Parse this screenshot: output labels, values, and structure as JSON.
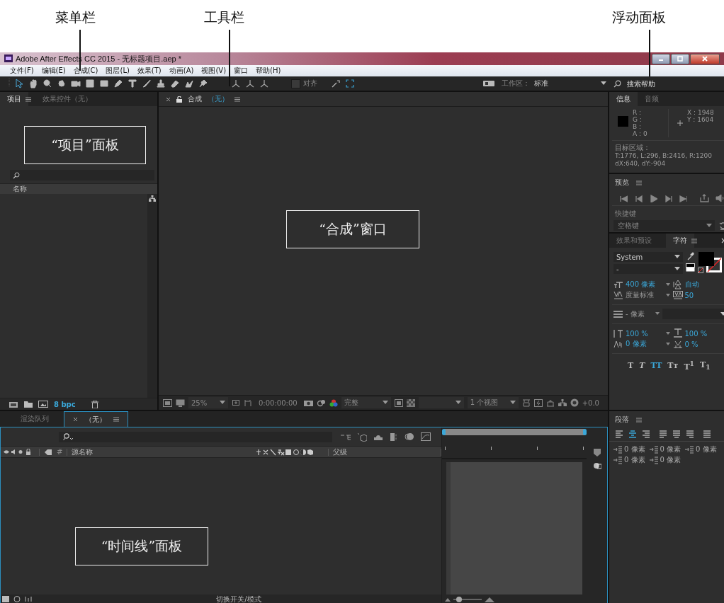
{
  "annotations": [
    {
      "label": "菜单栏"
    },
    {
      "label": "工具栏"
    },
    {
      "label": "浮动面板"
    }
  ],
  "callouts": [
    {
      "label": "“项目”面板"
    },
    {
      "label": "“合成”窗口"
    },
    {
      "label": "“时间线”面板"
    }
  ],
  "window": {
    "title": "Adobe After Effects CC 2015 - 无标题项目.aep *"
  },
  "menu": [
    {
      "label": "文件(F)"
    },
    {
      "label": "编辑(E)"
    },
    {
      "label": "合成(C)"
    },
    {
      "label": "图层(L)"
    },
    {
      "label": "效果(T)"
    },
    {
      "label": "动画(A)"
    },
    {
      "label": "视图(V)"
    },
    {
      "label": "窗口"
    },
    {
      "label": "帮助(H)"
    }
  ],
  "toolbar": {
    "snap": {
      "label": "对齐",
      "checked": false
    },
    "workspace_label": "工作区：",
    "workspace": "标准",
    "search": {
      "placeholder": "搜索帮助"
    }
  },
  "project": {
    "tabs": [
      {
        "label": "项目",
        "selected": true
      },
      {
        "label": "效果控件（无）",
        "selected": false
      }
    ],
    "name_column": "名称",
    "bpc": "8 bpc"
  },
  "composition": {
    "tab": {
      "label": "合成",
      "comp": "（无）"
    },
    "zoom": "25%",
    "timecode": "0:00:00:00",
    "resolution": "完整",
    "views": "1 个视图",
    "exposure": "+0.0"
  },
  "info": {
    "tabs": [
      {
        "label": "信息",
        "selected": true
      },
      {
        "label": "音频",
        "selected": false
      }
    ],
    "channels": [
      "R :",
      "G :",
      "B :",
      "A : 0"
    ],
    "coords": [
      "X : 1948",
      "Y : 1604"
    ],
    "target_label": "目标区域：",
    "target": "T:1776, L:296, B:2416, R:1200",
    "delta": "dX:640, dY:-904"
  },
  "preview": {
    "title": "预览",
    "shortcut_label": "快捷键",
    "shortcut": "空格键"
  },
  "character": {
    "tabs": [
      {
        "label": "效果和预设",
        "selected": false
      },
      {
        "label": "字符",
        "selected": true
      }
    ],
    "font": "System",
    "style": "-",
    "size": "400 像素",
    "leading": "自动",
    "kerning": "度量标准",
    "tracking": "50",
    "stroke": "- 像素",
    "vertical_scale": "100 %",
    "horizontal_scale": "100 %",
    "baseline_shift": "0 像素",
    "tsume": "0 %",
    "styles": [
      {
        "label": "T",
        "selected": false
      },
      {
        "label": "*T*",
        "selected": false
      },
      {
        "label": "TT",
        "selected": true
      },
      {
        "label": "Tт",
        "selected": false
      },
      {
        "label": "T$^{1}$",
        "selected": false
      },
      {
        "label": "T$_{1}$",
        "selected": false
      }
    ]
  },
  "paragraph": {
    "title": "段落",
    "alignments": [
      {
        "selected": false
      },
      {
        "selected": true
      },
      {
        "selected": false
      },
      {
        "selected": false
      },
      {
        "selected": false
      },
      {
        "selected": false
      },
      {
        "selected": false
      }
    ],
    "indents": [
      "0 像素",
      "0 像素",
      "0 像素",
      "0 像素",
      "0 像素"
    ]
  },
  "timeline": {
    "tabs": [
      {
        "label": "渲染队列",
        "selected": false,
        "closable": false
      },
      {
        "label": "（无）",
        "selected": true,
        "closable": true
      }
    ],
    "columns": [
      "#",
      "源名称",
      "父级"
    ],
    "toggle_label": "切换开关/模式",
    "zoom": {
      "level": 0.2
    }
  }
}
